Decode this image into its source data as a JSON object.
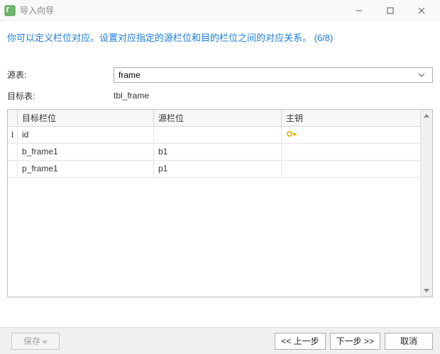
{
  "titlebar": {
    "title": "导入向导"
  },
  "instruction": "你可以定义栏位对应。设置对应指定的源栏位和目的栏位之间的对应关系。 (6/8)",
  "form": {
    "source_table_label": "源表:",
    "source_table_value": "frame",
    "target_table_label": "目标表:",
    "target_table_value": "tbl_frame"
  },
  "grid": {
    "headers": {
      "target": "目标栏位",
      "source": "源栏位",
      "key": "主钥"
    },
    "rows": [
      {
        "target": "id",
        "source": "",
        "is_key": true,
        "cursor": true
      },
      {
        "target": "b_frame1",
        "source": "b1",
        "is_key": false,
        "cursor": false
      },
      {
        "target": "p_frame1",
        "source": "p1",
        "is_key": false,
        "cursor": false
      }
    ]
  },
  "buttons": {
    "save": "保存",
    "prev": "上一步",
    "next": "下一步",
    "cancel": "取消"
  }
}
